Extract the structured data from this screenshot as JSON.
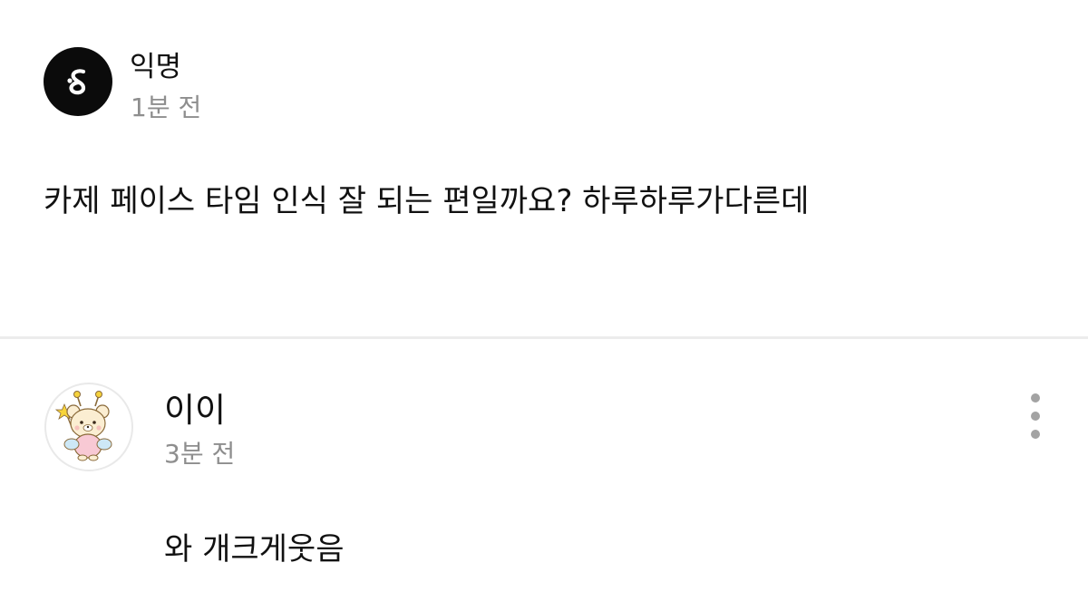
{
  "post": {
    "author": "익명",
    "time": "1분 전",
    "body": "카제 페이스 타임 인식 잘 되는 편일까요? 하루하루가다른데",
    "avatar_icon": "anonymous-logo-icon",
    "avatar_color": "#0b0b0b"
  },
  "comment": {
    "author": "이이",
    "time": "3분 전",
    "body": "와 개크게웃음",
    "avatar_icon": "bear-fairy-avatar-icon",
    "more_icon": "more-vertical-icon"
  },
  "colors": {
    "text": "#111111",
    "muted": "#8e8e8e",
    "divider": "#ececec",
    "icon_gray": "#a3a3a3"
  }
}
